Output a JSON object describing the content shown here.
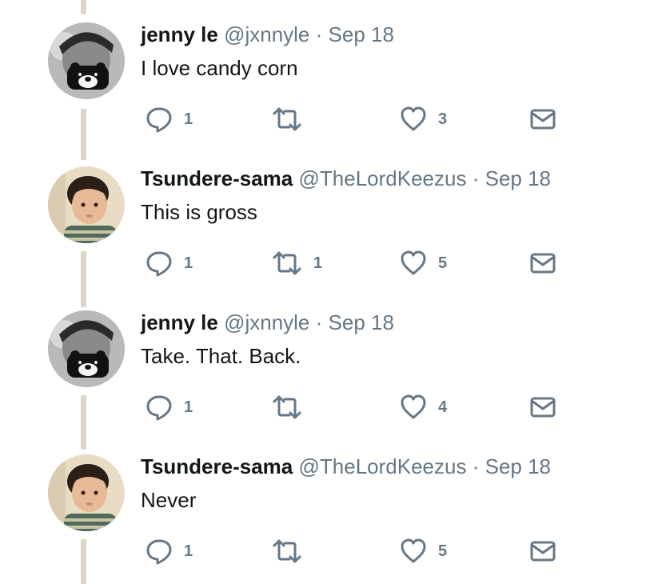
{
  "tweets": [
    {
      "avatar": "black-cat-mask-avatar",
      "name": "jenny le",
      "handle": "@jxnnyle",
      "separator": "·",
      "date": "Sep 18",
      "text": "I love candy corn",
      "replies": "1",
      "retweets": "",
      "likes": "3"
    },
    {
      "avatar": "toddler-photo-avatar",
      "name": "Tsundere-sama",
      "handle": "@TheLordKeezus",
      "separator": "·",
      "date": "Sep 18",
      "text": "This is gross",
      "replies": "1",
      "retweets": "1",
      "likes": "5"
    },
    {
      "avatar": "black-cat-mask-avatar",
      "name": "jenny le",
      "handle": "@jxnnyle",
      "separator": "·",
      "date": "Sep 18",
      "text": "Take. That. Back.",
      "replies": "1",
      "retweets": "",
      "likes": "4"
    },
    {
      "avatar": "toddler-photo-avatar",
      "name": "Tsundere-sama",
      "handle": "@TheLordKeezus",
      "separator": "·",
      "date": "Sep 18",
      "text": "Never",
      "replies": "1",
      "retweets": "",
      "likes": "5"
    }
  ],
  "icons": {
    "reply": "reply-bubble-icon",
    "retweet": "retweet-arrows-icon",
    "like": "heart-icon",
    "dm": "envelope-icon"
  },
  "colors": {
    "text": "#14171a",
    "secondary": "#657786",
    "thread_line": "#dcd3cb"
  }
}
